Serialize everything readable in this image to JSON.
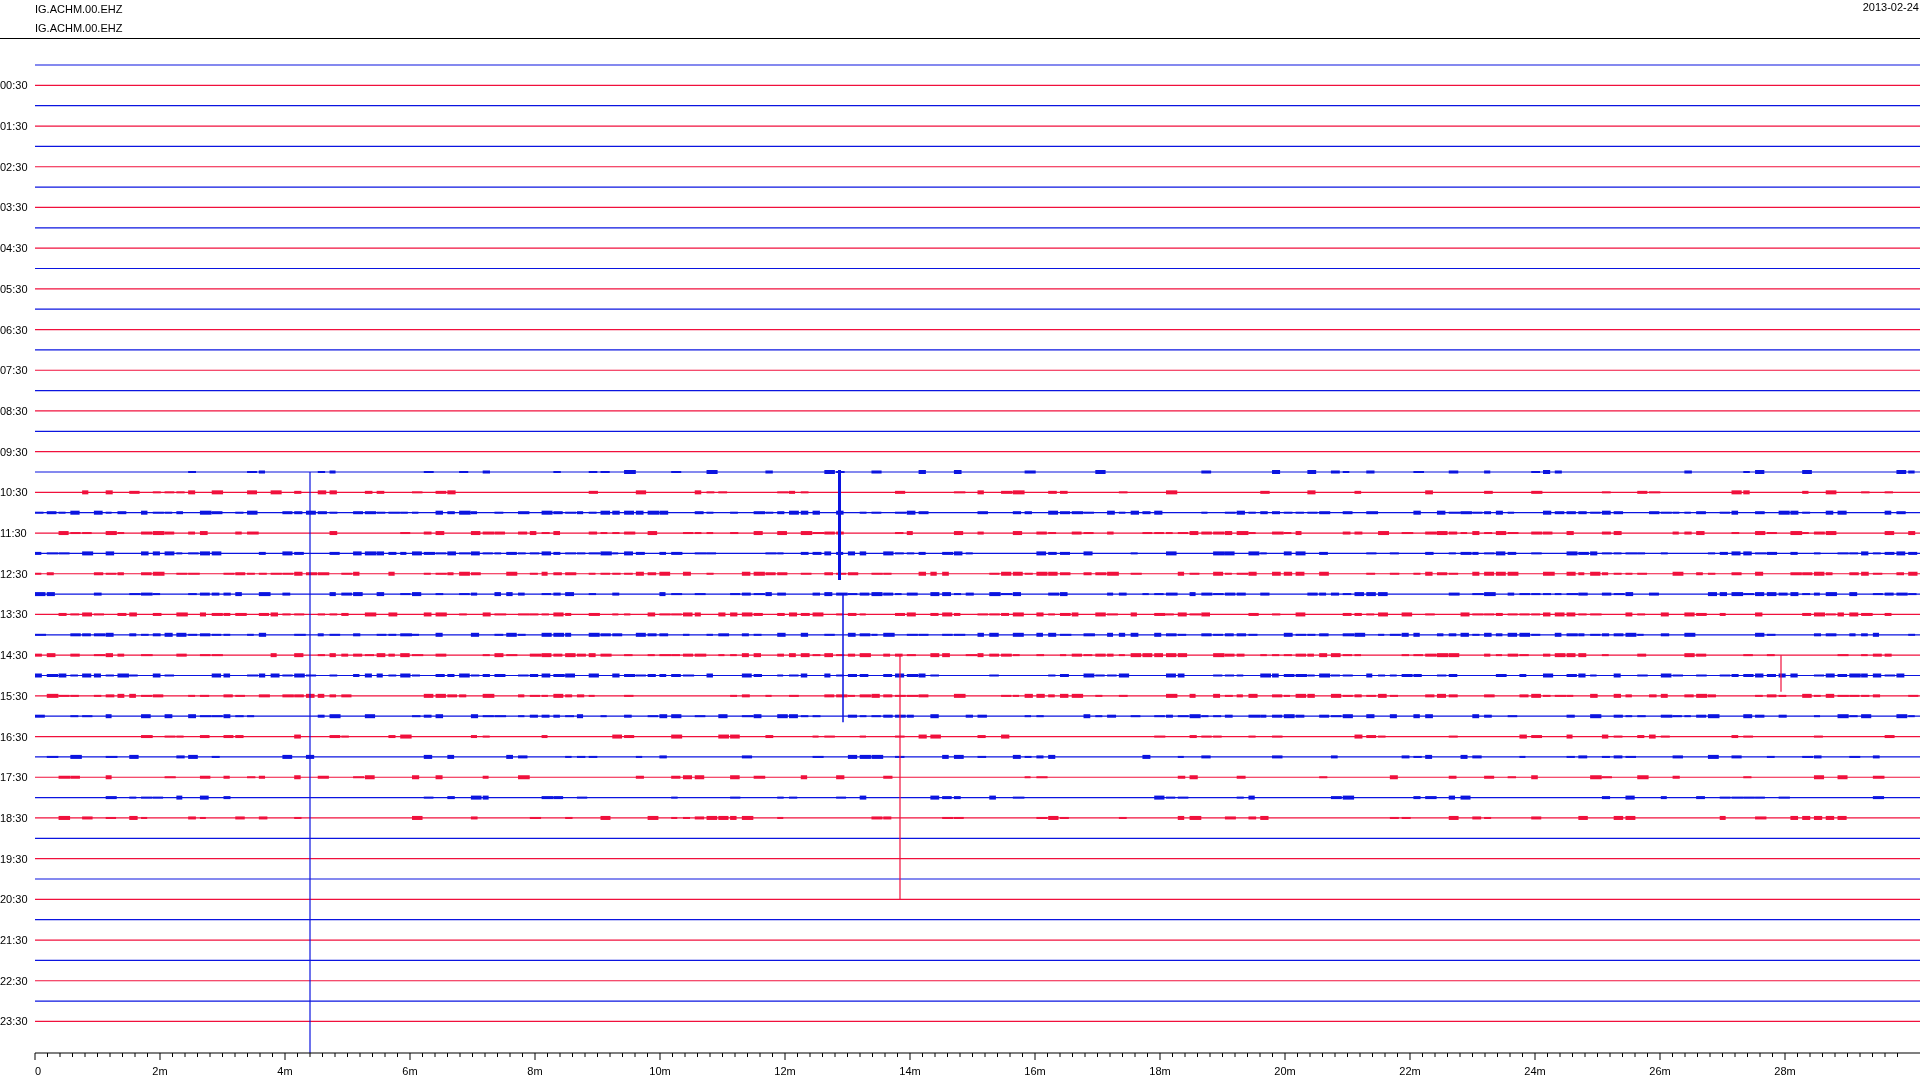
{
  "header": {
    "channels": [
      "IG.ACHM.00.EHZ",
      "IG.ACHM.00.EHZ"
    ],
    "date": "2013-02-24"
  },
  "hour_labels": [
    "00:30",
    "01:30",
    "02:30",
    "03:30",
    "04:30",
    "05:30",
    "06:30",
    "07:30",
    "08:30",
    "09:30",
    "10:30",
    "11:30",
    "12:30",
    "13:30",
    "14:30",
    "15:30",
    "16:30",
    "17:30",
    "18:30",
    "19:30",
    "20:30",
    "21:30",
    "22:30",
    "23:30"
  ],
  "time_axis": {
    "labels": [
      "0",
      "2m",
      "4m",
      "6m",
      "8m",
      "10m",
      "12m",
      "14m",
      "16m",
      "18m",
      "20m",
      "22m",
      "24m",
      "26m",
      "28m"
    ]
  }
}
